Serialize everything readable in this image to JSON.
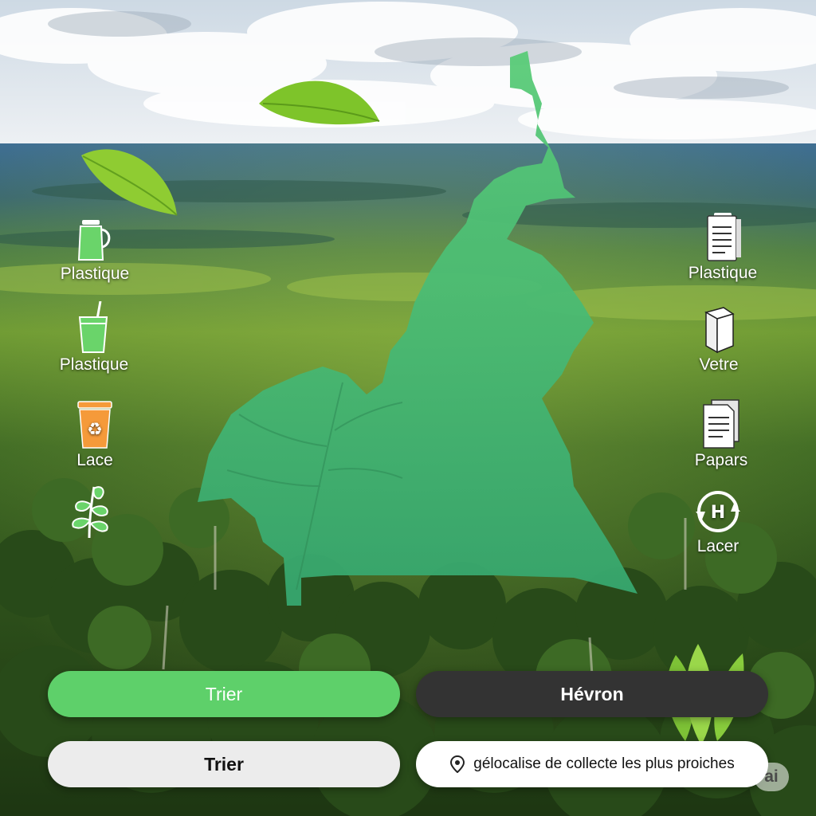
{
  "colors": {
    "accent_green": "#5ed06a",
    "map_green": "#5acc78",
    "dark_button": "#333333",
    "light_button": "#ececec",
    "recycle_orange": "#f59a3a"
  },
  "left_categories": [
    {
      "label": "Plastique",
      "icon": "plastic-jug-icon"
    },
    {
      "label": "Plastique",
      "icon": "plastic-cup-straw-icon"
    },
    {
      "label": "Lace",
      "icon": "recycle-bin-icon"
    },
    {
      "label": "",
      "icon": "plant-sprig-icon"
    }
  ],
  "right_categories": [
    {
      "label": "Plastique",
      "icon": "paper-document-icon"
    },
    {
      "label": "Vetre",
      "icon": "glass-box-icon"
    },
    {
      "label": "Papars",
      "icon": "paper-stack-icon"
    },
    {
      "label": "Lacer",
      "icon": "recycle-arrows-icon"
    }
  ],
  "buttons": {
    "sort_primary": "Trier",
    "hevron": "Hévron",
    "sort_secondary": "Trier",
    "locate": "gélocalise de collecte les plus proiches",
    "locate_icon": "location-pin-icon"
  },
  "watermark": "ai"
}
